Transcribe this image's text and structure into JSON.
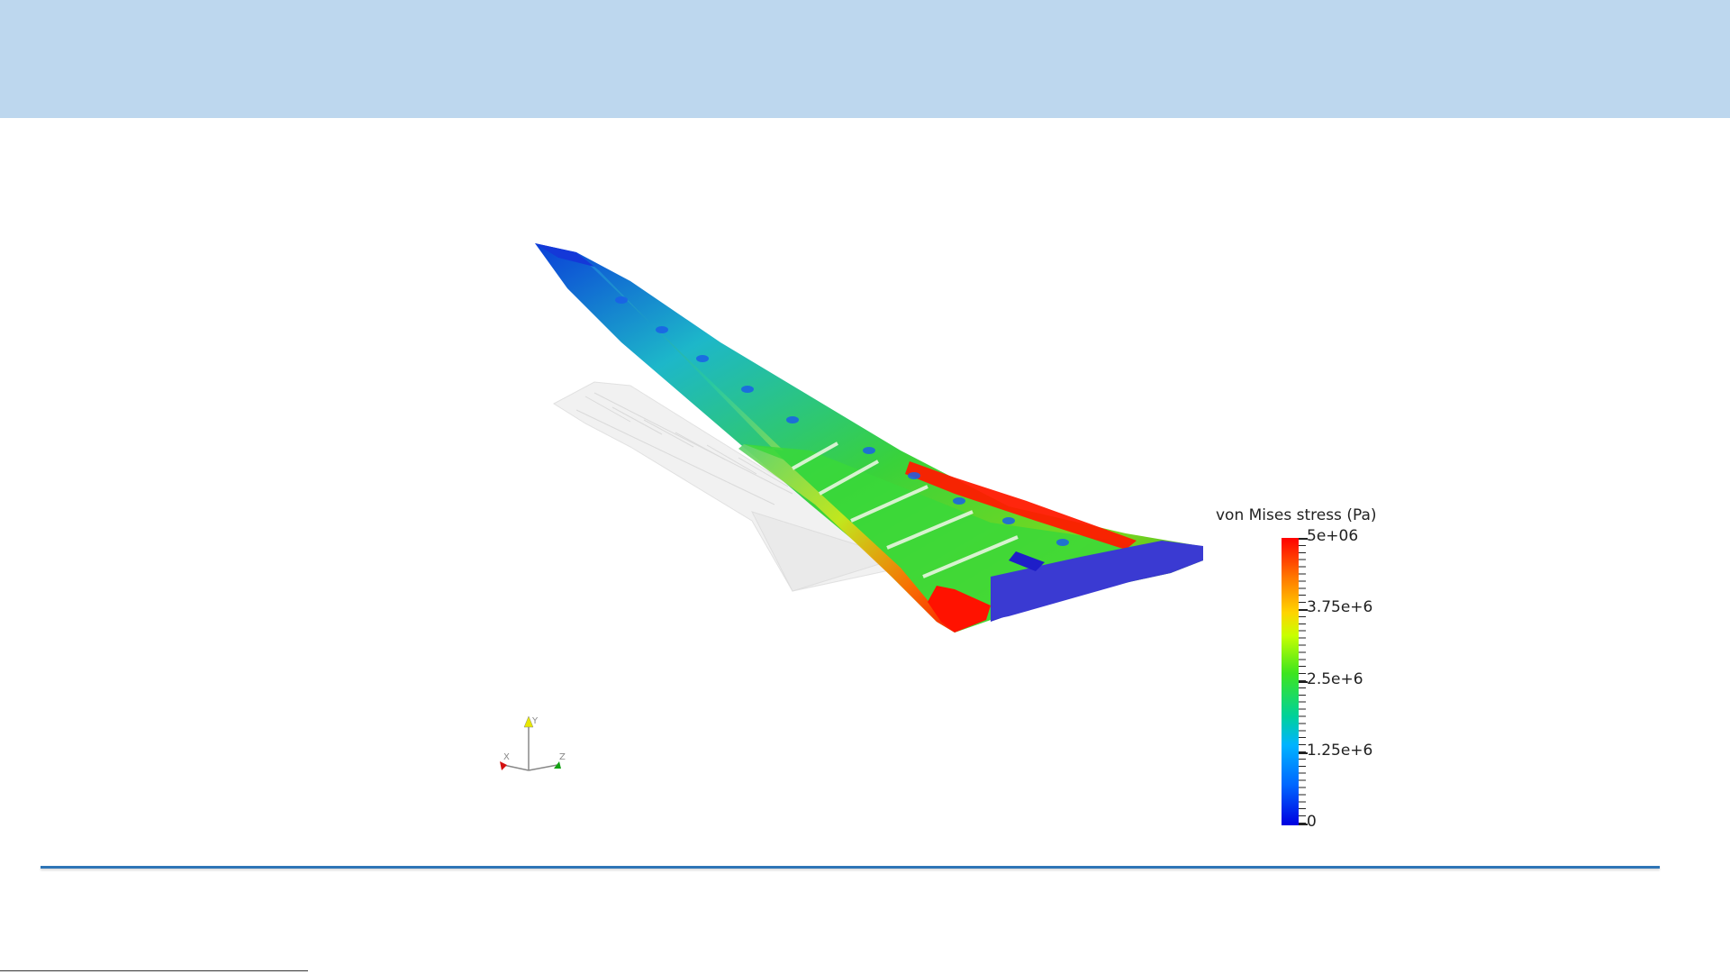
{
  "legend": {
    "title": "von Mises stress (Pa)",
    "ticks": [
      "5e+06",
      "3.75e+6",
      "2.5e+6",
      "1.25e+6",
      "0"
    ],
    "colors": {
      "max": "#ff0000",
      "high": "#ffd400",
      "mid": "#3ee51e",
      "low": "#00b4ff",
      "min": "#0000e0"
    }
  },
  "axes": {
    "x_label": "X",
    "y_label": "Y",
    "z_label": "Z"
  },
  "theme": {
    "header_color": "#bdd7ee",
    "footer_line_color": "#2e75b6"
  }
}
